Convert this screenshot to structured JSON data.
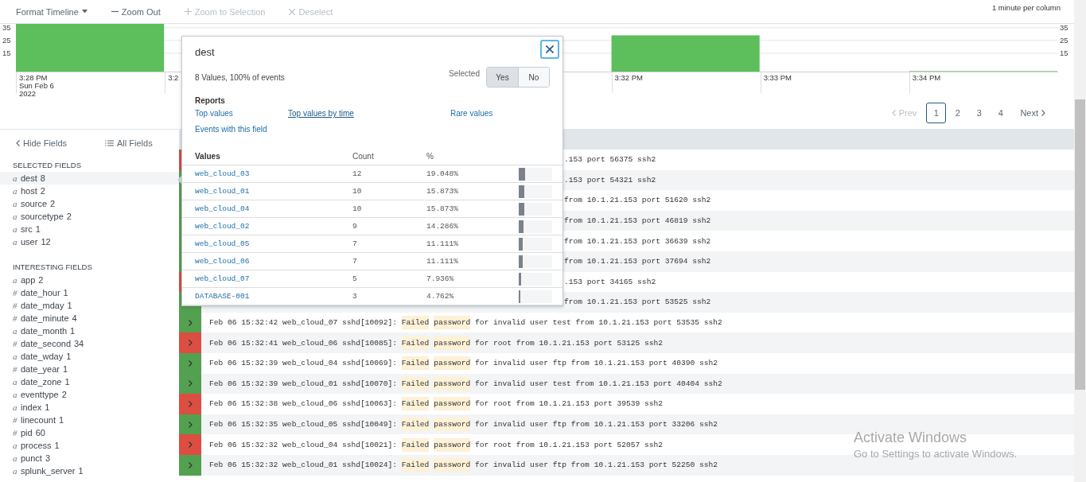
{
  "toolbar": {
    "items": [
      {
        "kind": "menu",
        "label": "Format Timeline",
        "disabled": false
      },
      {
        "kind": "zoom_out",
        "label": "Zoom Out",
        "disabled": false
      },
      {
        "kind": "zoom_in",
        "label": "Zoom to Selection",
        "disabled": true
      },
      {
        "kind": "clear",
        "label": "Deselect",
        "disabled": true
      }
    ],
    "scale_note": "1 minute per column"
  },
  "timeline": {
    "chart_data": {
      "type": "bar",
      "categories": [
        "3:28 PM",
        "3:2",
        null,
        null,
        "3:32 PM",
        "3:33 PM",
        "3:34 PM"
      ],
      "series": [
        {
          "color": "#5cbf5c",
          "values": [
            38,
            null,
            null,
            0,
            29,
            0,
            1
          ]
        }
      ],
      "ylim": [
        0,
        38
      ],
      "yticks": [
        {
          "value": 35,
          "label": "35"
        },
        {
          "value": 25,
          "label": "25"
        },
        {
          "value": 15,
          "label": "15"
        }
      ],
      "grid": true
    },
    "date_lines": [
      "Sun Feb 6",
      "2022"
    ],
    "right_axis_labels": [
      "35",
      "25",
      "15"
    ]
  },
  "pagination": {
    "prev": {
      "label": "Prev",
      "disabled": true
    },
    "pages": [
      {
        "label": "1",
        "selected": true
      },
      {
        "label": "2",
        "selected": false
      },
      {
        "label": "3",
        "selected": false
      },
      {
        "label": "4",
        "selected": false
      }
    ],
    "next": {
      "label": "Next",
      "disabled": false
    }
  },
  "sidebar": {
    "hide_label": "Hide Fields",
    "all_label": "All Fields",
    "sections": [
      {
        "title": "SELECTED FIELDS",
        "fields": [
          {
            "type": "a",
            "name": "dest",
            "count": "8",
            "selected": true
          },
          {
            "type": "a",
            "name": "host",
            "count": "2",
            "selected": false
          },
          {
            "type": "a",
            "name": "source",
            "count": "2",
            "selected": false
          },
          {
            "type": "a",
            "name": "sourcetype",
            "count": "2",
            "selected": false
          },
          {
            "type": "a",
            "name": "src",
            "count": "1",
            "selected": false
          },
          {
            "type": "a",
            "name": "user",
            "count": "12",
            "selected": false
          }
        ]
      },
      {
        "title": "INTERESTING FIELDS",
        "fields": [
          {
            "type": "a",
            "name": "app",
            "count": "2",
            "selected": false
          },
          {
            "type": "#",
            "name": "date_hour",
            "count": "1",
            "selected": false
          },
          {
            "type": "#",
            "name": "date_mday",
            "count": "1",
            "selected": false
          },
          {
            "type": "#",
            "name": "date_minute",
            "count": "4",
            "selected": false
          },
          {
            "type": "a",
            "name": "date_month",
            "count": "1",
            "selected": false
          },
          {
            "type": "#",
            "name": "date_second",
            "count": "34",
            "selected": false
          },
          {
            "type": "a",
            "name": "date_wday",
            "count": "1",
            "selected": false
          },
          {
            "type": "#",
            "name": "date_year",
            "count": "1",
            "selected": false
          },
          {
            "type": "a",
            "name": "date_zone",
            "count": "1",
            "selected": false
          },
          {
            "type": "a",
            "name": "eventtype",
            "count": "2",
            "selected": false
          },
          {
            "type": "a",
            "name": "index",
            "count": "1",
            "selected": false
          },
          {
            "type": "#",
            "name": "linecount",
            "count": "1",
            "selected": false
          },
          {
            "type": "#",
            "name": "pid",
            "count": "60",
            "selected": false
          },
          {
            "type": "a",
            "name": "process",
            "count": "1",
            "selected": false
          },
          {
            "type": "a",
            "name": "punct",
            "count": "3",
            "selected": false
          },
          {
            "type": "a",
            "name": "splunk_server",
            "count": "1",
            "selected": false
          }
        ]
      }
    ]
  },
  "events": [
    {
      "kind": "covered",
      "color": "#dc4e41",
      "text": ".153 port 56375 ssh2"
    },
    {
      "kind": "covered",
      "color": "#53a051",
      "text": ".153 port 54321 ssh2"
    },
    {
      "kind": "covered",
      "color": "#53a051",
      "text": "from 10.1.21.153 port 51620 ssh2"
    },
    {
      "kind": "covered",
      "color": "#53a051",
      "text": "from 10.1.21.153 port 46819 ssh2"
    },
    {
      "kind": "covered",
      "color": "#53a051",
      "text": "from 10.1.21.153 port 36639 ssh2"
    },
    {
      "kind": "covered",
      "color": "#53a051",
      "text": "from 10.1.21.153 port 37694 ssh2"
    },
    {
      "kind": "covered",
      "color": "#dc4e41",
      "text": ".153 port 34165 ssh2"
    },
    {
      "kind": "covered",
      "color": "#53a051",
      "text": "from 10.1.21.153 port 53525 ssh2"
    },
    {
      "kind": "full",
      "color": "#53a051",
      "prefix": "Feb 06 15:32:42 web_cloud_07 sshd[10092]:",
      "terms": [
        "Failed",
        "password"
      ],
      "rest": "for invalid user test from 10.1.21.153 port 53535 ssh2"
    },
    {
      "kind": "full",
      "color": "#dc4e41",
      "prefix": "Feb 06 15:32:41 web_cloud_06 sshd[10085]:",
      "terms": [
        "Failed",
        "password"
      ],
      "rest": "for root from 10.1.21.153 port 53125 ssh2"
    },
    {
      "kind": "full",
      "color": "#53a051",
      "prefix": "Feb 06 15:32:39 web_cloud_04 sshd[10069]:",
      "terms": [
        "Failed",
        "password"
      ],
      "rest": "for invalid user ftp from 10.1.21.153 port 40390 ssh2"
    },
    {
      "kind": "full",
      "color": "#53a051",
      "prefix": "Feb 06 15:32:39 web_cloud_01 sshd[10070]:",
      "terms": [
        "Failed",
        "password"
      ],
      "rest": "for invalid user test from 10.1.21.153 port 40404 ssh2"
    },
    {
      "kind": "full",
      "color": "#dc4e41",
      "prefix": "Feb 06 15:32:38 web_cloud_06 sshd[10063]:",
      "terms": [
        "Failed",
        "password"
      ],
      "rest": "for root from 10.1.21.153 port 39539 ssh2"
    },
    {
      "kind": "full",
      "color": "#53a051",
      "prefix": "Feb 06 15:32:35 web_cloud_05 sshd[10049]:",
      "terms": [
        "Failed",
        "password"
      ],
      "rest": "for invalid user ftp from 10.1.21.153 port 33206 ssh2"
    },
    {
      "kind": "full",
      "color": "#dc4e41",
      "prefix": "Feb 06 15:32:32 web_cloud_04 sshd[10021]:",
      "terms": [
        "Failed",
        "password"
      ],
      "rest": "for root from 10.1.21.153 port 52057 ssh2"
    },
    {
      "kind": "full",
      "color": "#53a051",
      "prefix": "Feb 06 15:32:32 web_cloud_01 sshd[10024]:",
      "terms": [
        "Failed",
        "password"
      ],
      "rest": "for invalid user ftp from 10.1.21.153 port 52250 ssh2"
    }
  ],
  "popup": {
    "title": "dest",
    "summary": "8 Values, 100% of events",
    "selected_label": "Selected",
    "toggle": [
      {
        "label": "Yes",
        "selected": true
      },
      {
        "label": "No",
        "selected": false
      }
    ],
    "reports_title": "Reports",
    "report_links": [
      {
        "label": "Top values",
        "hover": false
      },
      {
        "label": "Top values by time",
        "hover": true
      },
      {
        "label": "Rare values",
        "hover": false
      },
      {
        "label": "Events with this field",
        "hover": false
      }
    ],
    "columns": [
      "Values",
      "Count",
      "%"
    ],
    "rows": [
      {
        "value": "web_cloud_03",
        "count": "12",
        "percent": "19.048%",
        "level": 0.19048
      },
      {
        "value": "web_cloud_01",
        "count": "10",
        "percent": "15.873%",
        "level": 0.15873
      },
      {
        "value": "web_cloud_04",
        "count": "10",
        "percent": "15.873%",
        "level": 0.15873
      },
      {
        "value": "web_cloud_02",
        "count": "9",
        "percent": "14.286%",
        "level": 0.14286
      },
      {
        "value": "web_cloud_05",
        "count": "7",
        "percent": "11.111%",
        "level": 0.11111
      },
      {
        "value": "web_cloud_06",
        "count": "7",
        "percent": "11.111%",
        "level": 0.11111
      },
      {
        "value": "web_cloud_07",
        "count": "5",
        "percent": "7.936%",
        "level": 0.07936
      },
      {
        "value": "DATABASE-001",
        "count": "3",
        "percent": "4.762%",
        "level": 0.04762
      }
    ]
  },
  "os_notice": {
    "title": "Activate Windows",
    "text": "Go to Settings to activate Windows."
  }
}
